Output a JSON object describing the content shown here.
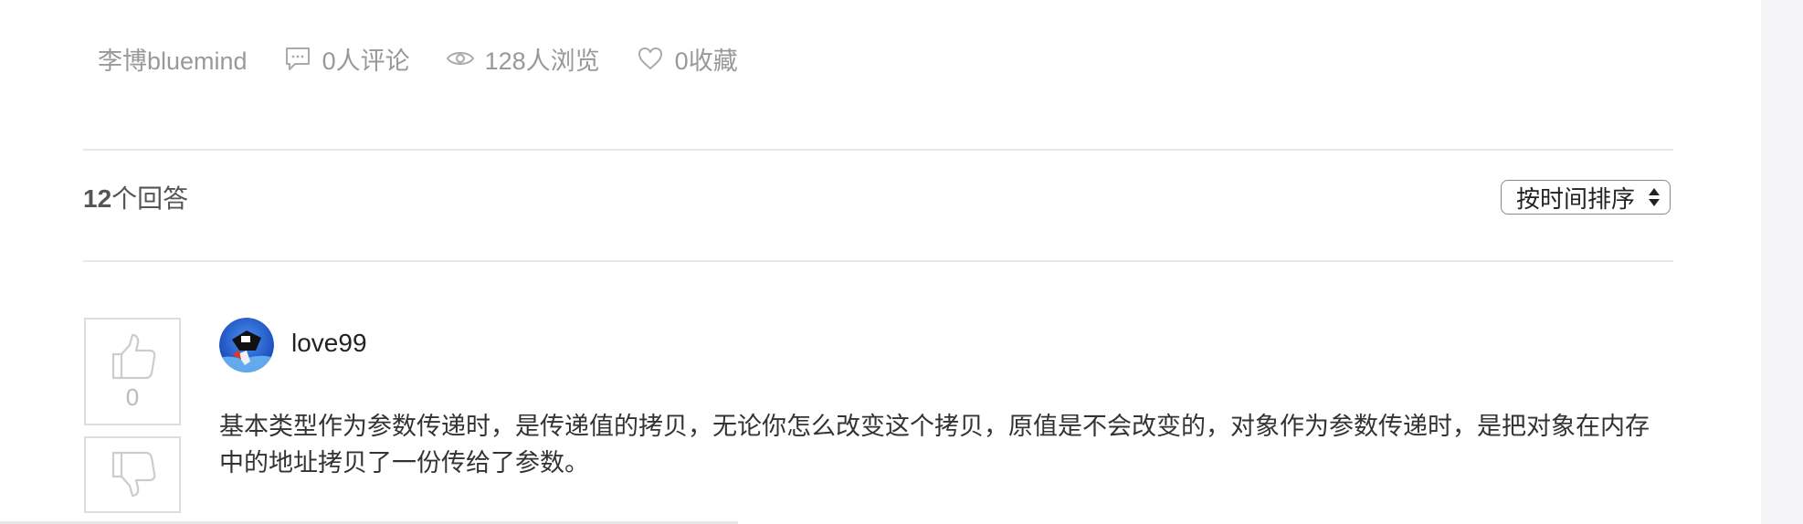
{
  "question_meta": {
    "author": "李博bluemind",
    "comments": "0人评论",
    "views": "128人浏览",
    "favorites": "0收藏"
  },
  "answers_header": {
    "count": "12",
    "count_suffix": "个回答",
    "sort_selected": "按时间排序"
  },
  "answer": {
    "vote_count": "0",
    "username": "love99",
    "body": "基本类型作为参数传递时，是传递值的拷贝，无论你怎么改变这个拷贝，原值是不会改变的，对象作为参数传递时，是把对象在内存中的地址拷贝了一份传给了参数。"
  },
  "icons": {
    "comments": "comment-bubble-icon",
    "views": "eye-icon",
    "favorites": "heart-icon",
    "vote_up": "thumbs-up-icon",
    "vote_down": "thumbs-down-icon",
    "sort": "select-arrows-icon"
  },
  "colors": {
    "meta_text": "#999999",
    "divider": "#e8e8e8",
    "avatar_blue": "#1e5fd6"
  }
}
